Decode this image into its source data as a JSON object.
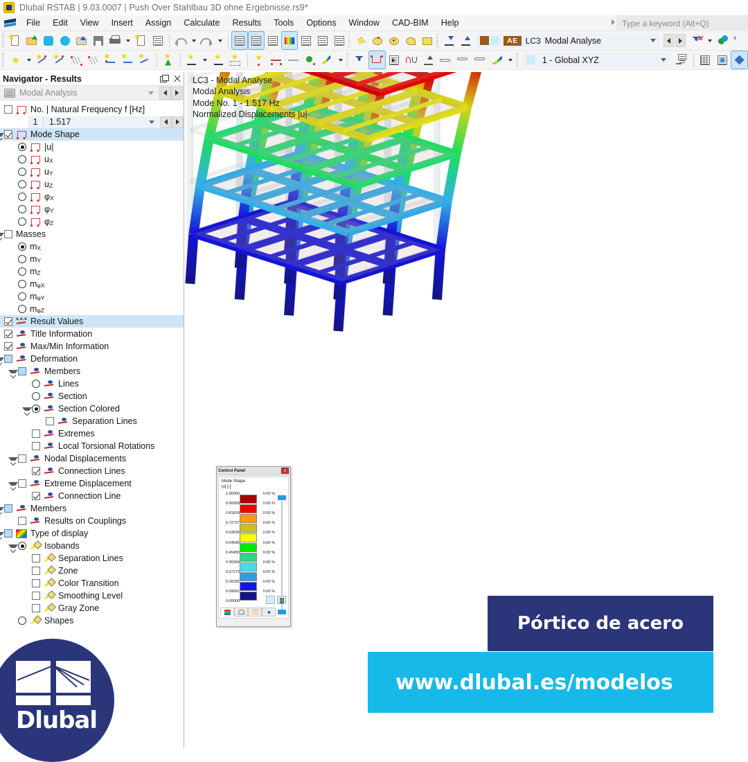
{
  "window": {
    "title": "Dlubal RSTAB | 9.03.0007 | Push Over Stahlbau 3D  ohne Ergebnisse.rs9*",
    "app_icon": "rstab-app-icon"
  },
  "menu": {
    "items": [
      "File",
      "Edit",
      "View",
      "Insert",
      "Assign",
      "Calculate",
      "Results",
      "Tools",
      "Options",
      "Window",
      "CAD-BIM",
      "Help"
    ],
    "search_placeholder": "Type a keyword (Alt+Q)"
  },
  "toolbar_top": {
    "buttons": [
      {
        "name": "new-model-icon",
        "kind": "page-star"
      },
      {
        "name": "open-folder-icon",
        "kind": "folder"
      },
      {
        "name": "rfem-link-icon",
        "kind": "blue-c"
      },
      {
        "name": "cloud-model-icon",
        "kind": "blue-globe"
      },
      {
        "name": "save-as-icon",
        "kind": "save-as"
      },
      {
        "name": "save-icon",
        "kind": "disk"
      },
      {
        "name": "print-icon",
        "kind": "printer"
      },
      {
        "name": "printout-report-icon",
        "kind": "page-star2"
      },
      {
        "name": "document-icon",
        "kind": "page"
      },
      {
        "name": "undo-icon",
        "kind": "undo"
      },
      {
        "name": "redo-icon",
        "kind": "redo"
      },
      {
        "name": "navigator-panel-icon",
        "kind": "panel"
      },
      {
        "name": "table-view-icon",
        "kind": "table"
      },
      {
        "name": "result-table-icon",
        "kind": "panel-color"
      },
      {
        "name": "console-icon",
        "kind": "console"
      },
      {
        "name": "script-icon",
        "kind": "script"
      },
      {
        "name": "info-panel-icon",
        "kind": "panel2"
      },
      {
        "name": "select-polygon-icon",
        "kind": "poly"
      },
      {
        "name": "select-special-icon",
        "kind": "lasso1"
      },
      {
        "name": "select-circle-icon",
        "kind": "lasso2"
      },
      {
        "name": "select-free-icon",
        "kind": "lasso3"
      },
      {
        "name": "select-box-icon",
        "kind": "boxplus"
      },
      {
        "name": "snap-top-icon",
        "kind": "snapt"
      },
      {
        "name": "snap-bottom-icon",
        "kind": "snapb"
      }
    ],
    "load_case": {
      "swatch_1": "#9c5a14",
      "swatch_2": "#c9f0f7",
      "badge": "AE",
      "id": "LC3",
      "description": "Modal Analyse"
    }
  },
  "toolbar_second": {
    "buttons": [
      {
        "name": "new-node-icon",
        "kind": "node"
      },
      {
        "name": "new-member-icon",
        "kind": "member1"
      },
      {
        "name": "new-member-2-icon",
        "kind": "member2"
      },
      {
        "name": "new-surface-icon",
        "kind": "surface1"
      },
      {
        "name": "new-surface-2-icon",
        "kind": "surface2"
      },
      {
        "name": "new-line-support-icon",
        "kind": "linesup"
      },
      {
        "name": "new-member-hinge-icon",
        "kind": "hinge"
      },
      {
        "name": "new-member-set-icon",
        "kind": "memberset"
      },
      {
        "name": "new-nodal-support-icon",
        "kind": "nodalsup"
      },
      {
        "name": "dimension-x-icon",
        "kind": "dimx"
      },
      {
        "name": "dimension-xx-icon",
        "kind": "dimxx"
      },
      {
        "name": "dimension-free-icon",
        "kind": "dimfree"
      },
      {
        "name": "new-load-icon",
        "kind": "loadstar"
      },
      {
        "name": "member-load-icon",
        "kind": "memberload"
      },
      {
        "name": "line-load-icon",
        "kind": "lineload"
      },
      {
        "name": "imperfection-icon",
        "kind": "imperf"
      },
      {
        "name": "load-wizard-icon",
        "kind": "wizard"
      },
      {
        "name": "render-filter-icon",
        "kind": "filter"
      },
      {
        "name": "deformation-view-icon",
        "kind": "defview"
      },
      {
        "name": "animation-icon",
        "kind": "anim"
      },
      {
        "name": "diagram-icon",
        "kind": "diagram"
      },
      {
        "name": "support-reaction-icon",
        "kind": "supreact"
      },
      {
        "name": "hinge-release-icon",
        "kind": "release1"
      },
      {
        "name": "hinge-release-2-icon",
        "kind": "release2"
      },
      {
        "name": "hinge-release-3-icon",
        "kind": "release3"
      },
      {
        "name": "color-scale-icon",
        "kind": "rainbow-pencil"
      },
      {
        "name": "coordinate-system-icon",
        "kind": "csys"
      },
      {
        "name": "grid-icon",
        "kind": "grid"
      },
      {
        "name": "snap-settings-icon",
        "kind": "snapset"
      },
      {
        "name": "ucs-icon",
        "kind": "ucs"
      }
    ],
    "coord_system": {
      "swatch": "#c9f0f7",
      "label": "1 - Global XYZ"
    }
  },
  "navigator": {
    "title": "Navigator - Results",
    "combo_label": "Modal Analysis",
    "tree": [
      {
        "id": "nat-freq",
        "indent": 1,
        "ctrl": "checkbox",
        "state": "off",
        "icon": "frame",
        "label": "No. | Natural Frequency f [Hz]",
        "expander": ""
      },
      {
        "id": "freq-combo",
        "indent": 2,
        "ctrl": "combo",
        "num": "1",
        "value": "1.517"
      },
      {
        "id": "mode-shape",
        "indent": 1,
        "ctrl": "checkbox",
        "state": "on",
        "icon": "frame",
        "label": "Mode Shape",
        "expander": "open",
        "selected": true
      },
      {
        "id": "u-abs",
        "indent": 2,
        "ctrl": "radio",
        "state": "on",
        "icon": "frame",
        "label": "|u|"
      },
      {
        "id": "ux",
        "indent": 2,
        "ctrl": "radio",
        "state": "off",
        "icon": "frame",
        "label": "u",
        "sub": "X"
      },
      {
        "id": "uy",
        "indent": 2,
        "ctrl": "radio",
        "state": "off",
        "icon": "frame",
        "label": "u",
        "sub": "Y"
      },
      {
        "id": "uz",
        "indent": 2,
        "ctrl": "radio",
        "state": "off",
        "icon": "frame",
        "label": "u",
        "sub": "Z"
      },
      {
        "id": "phix",
        "indent": 2,
        "ctrl": "radio",
        "state": "off",
        "icon": "frame",
        "label": "φ",
        "sub": "X"
      },
      {
        "id": "phiy",
        "indent": 2,
        "ctrl": "radio",
        "state": "off",
        "icon": "frame",
        "label": "φ",
        "sub": "Y"
      },
      {
        "id": "phiz",
        "indent": 2,
        "ctrl": "radio",
        "state": "off",
        "icon": "frame",
        "label": "φ",
        "sub": "Z"
      },
      {
        "id": "masses",
        "indent": 1,
        "ctrl": "checkbox",
        "state": "off",
        "icon": "none",
        "label": "Masses",
        "expander": "open"
      },
      {
        "id": "mx",
        "indent": 2,
        "ctrl": "radio",
        "state": "on",
        "icon": "none",
        "label": "m",
        "sub": "X"
      },
      {
        "id": "my",
        "indent": 2,
        "ctrl": "radio",
        "state": "off",
        "icon": "none",
        "label": "m",
        "sub": "Y"
      },
      {
        "id": "mz",
        "indent": 2,
        "ctrl": "radio",
        "state": "off",
        "icon": "none",
        "label": "m",
        "sub": "Z"
      },
      {
        "id": "mphix",
        "indent": 2,
        "ctrl": "radio",
        "state": "off",
        "icon": "none",
        "label": "m",
        "sub": "φX"
      },
      {
        "id": "mphiy",
        "indent": 2,
        "ctrl": "radio",
        "state": "off",
        "icon": "none",
        "label": "m",
        "sub": "φY"
      },
      {
        "id": "mphiz",
        "indent": 2,
        "ctrl": "radio",
        "state": "off",
        "icon": "none",
        "label": "m",
        "sub": "φZ"
      },
      {
        "id": "result-values",
        "indent": 1,
        "ctrl": "checkbox",
        "state": "on",
        "icon": "xxx",
        "label": "Result Values",
        "selected": true
      },
      {
        "id": "title-information",
        "indent": 1,
        "ctrl": "checkbox",
        "state": "on",
        "icon": "defo",
        "label": "Title Information"
      },
      {
        "id": "maxmin-information",
        "indent": 1,
        "ctrl": "checkbox",
        "state": "on",
        "icon": "defo",
        "label": "Max/Min Information"
      },
      {
        "id": "deformation",
        "indent": 1,
        "ctrl": "checkbox",
        "state": "part",
        "icon": "defo",
        "label": "Deformation",
        "expander": "open"
      },
      {
        "id": "def-members",
        "indent": 2,
        "ctrl": "checkbox",
        "state": "part",
        "icon": "defo",
        "label": "Members",
        "expander": "open"
      },
      {
        "id": "def-lines",
        "indent": 3,
        "ctrl": "radio",
        "state": "off",
        "icon": "defo",
        "label": "Lines"
      },
      {
        "id": "def-section",
        "indent": 3,
        "ctrl": "radio",
        "state": "off",
        "icon": "defo",
        "label": "Section"
      },
      {
        "id": "def-section-colored",
        "indent": 3,
        "ctrl": "radio",
        "state": "on",
        "icon": "defo",
        "label": "Section Colored",
        "expander": "open"
      },
      {
        "id": "def-separation-lines",
        "indent": 4,
        "ctrl": "checkbox",
        "state": "off",
        "icon": "defo",
        "label": "Separation Lines"
      },
      {
        "id": "def-extremes",
        "indent": 3,
        "ctrl": "checkbox",
        "state": "off",
        "icon": "defo",
        "label": "Extremes"
      },
      {
        "id": "def-local-torsional",
        "indent": 3,
        "ctrl": "checkbox",
        "state": "off",
        "icon": "defo",
        "label": "Local Torsional Rotations"
      },
      {
        "id": "nodal-displacements",
        "indent": 2,
        "ctrl": "checkbox",
        "state": "off",
        "icon": "defo",
        "label": "Nodal Displacements",
        "expander": "open"
      },
      {
        "id": "nd-connection-lines",
        "indent": 3,
        "ctrl": "checkbox",
        "state": "on",
        "icon": "defo",
        "label": "Connection Lines"
      },
      {
        "id": "extreme-displacement",
        "indent": 2,
        "ctrl": "checkbox",
        "state": "off",
        "icon": "defo",
        "label": "Extreme Displacement",
        "expander": "open"
      },
      {
        "id": "ed-connection-line",
        "indent": 3,
        "ctrl": "checkbox",
        "state": "on",
        "icon": "defo",
        "label": "Connection Line"
      },
      {
        "id": "members",
        "indent": 1,
        "ctrl": "checkbox",
        "state": "part",
        "icon": "defo",
        "label": "Members",
        "expander": "open"
      },
      {
        "id": "results-on-couplings",
        "indent": 2,
        "ctrl": "checkbox",
        "state": "off",
        "icon": "defo",
        "label": "Results on Couplings"
      },
      {
        "id": "type-of-display",
        "indent": 1,
        "ctrl": "checkbox",
        "state": "part",
        "icon": "rain",
        "label": "Type of display",
        "expander": "open"
      },
      {
        "id": "isobands",
        "indent": 2,
        "ctrl": "radio",
        "state": "on",
        "icon": "pencil",
        "label": "Isobands",
        "expander": "open"
      },
      {
        "id": "iso-separation-lines",
        "indent": 3,
        "ctrl": "checkbox",
        "state": "off",
        "icon": "pencil",
        "label": "Separation Lines"
      },
      {
        "id": "iso-zone",
        "indent": 3,
        "ctrl": "checkbox",
        "state": "off",
        "icon": "pencil",
        "label": "Zone"
      },
      {
        "id": "iso-color-transition",
        "indent": 3,
        "ctrl": "checkbox",
        "state": "off",
        "icon": "pencil",
        "label": "Color Transition"
      },
      {
        "id": "iso-smoothing-level",
        "indent": 3,
        "ctrl": "checkbox",
        "state": "off",
        "icon": "pencil",
        "label": "Smoothing Level"
      },
      {
        "id": "iso-gray-zone",
        "indent": 3,
        "ctrl": "checkbox",
        "state": "off",
        "icon": "pencil",
        "label": "Gray Zone"
      },
      {
        "id": "shapes",
        "indent": 2,
        "ctrl": "radio",
        "state": "off",
        "icon": "pencil",
        "label": "Shapes"
      }
    ]
  },
  "viewport": {
    "title_lines": [
      "LC3 - Modal Analyse",
      "Modal Analysis",
      "Mode No. 1 - 1.517 Hz",
      "Normalized Displacements |u|"
    ]
  },
  "control_panel": {
    "title": "Control Panel",
    "close_label": "x",
    "subtitle_line1": "Mode Shape",
    "subtitle_line2": "|u| [-]",
    "legend": [
      {
        "value": "1.00000",
        "color": "#a80000",
        "pct": "0.00 %"
      },
      {
        "value": "0.90909",
        "color": "#f50000",
        "pct": "0.00 %"
      },
      {
        "value": "0.81818",
        "color": "#ff9a00",
        "pct": "0.00 %"
      },
      {
        "value": "0.72727",
        "color": "#c8c221",
        "pct": "0.00 %"
      },
      {
        "value": "0.63636",
        "color": "#fdfd00",
        "pct": "0.00 %"
      },
      {
        "value": "0.54545",
        "color": "#00e800",
        "pct": "0.00 %"
      },
      {
        "value": "0.45455",
        "color": "#2ad888",
        "pct": "0.00 %"
      },
      {
        "value": "0.36364",
        "color": "#40e0e8",
        "pct": "0.00 %"
      },
      {
        "value": "0.27273",
        "color": "#2c9ce8",
        "pct": "0.00 %"
      },
      {
        "value": "0.18182",
        "color": "#1414ee",
        "pct": "0.00 %"
      },
      {
        "value": "0.09091",
        "color": "#141487",
        "pct": "0.00 %"
      },
      {
        "value": "0.00000",
        "color": "",
        "pct": ""
      }
    ],
    "tabs": [
      "color-scale-tab",
      "factors-tab",
      "filter-tab",
      "display-tab"
    ],
    "tools": [
      "edit-scale-icon",
      "color-spectrum-icon"
    ]
  },
  "branding": {
    "logo_text": "Dlubal",
    "banner_model": "Pórtico de acero",
    "banner_url": "www.dlubal.es/modelos",
    "dark_color": "#2b3579",
    "cyan_color": "#16b9e8"
  },
  "chart_data": {
    "type": "heatmap",
    "title": "Mode Shape |u| [-]",
    "legend_values": [
      1.0,
      0.90909,
      0.81818,
      0.72727,
      0.63636,
      0.54545,
      0.45455,
      0.36364,
      0.27273,
      0.18182,
      0.09091,
      0.0
    ],
    "legend_colors": [
      "#a80000",
      "#f50000",
      "#ff9a00",
      "#c8c221",
      "#fdfd00",
      "#00e800",
      "#2ad888",
      "#40e0e8",
      "#2c9ce8",
      "#1414ee",
      "#141487"
    ],
    "legend_percentages": [
      "0.00 %",
      "0.00 %",
      "0.00 %",
      "0.00 %",
      "0.00 %",
      "0.00 %",
      "0.00 %",
      "0.00 %",
      "0.00 %",
      "0.00 %",
      "0.00 %"
    ],
    "frequency_hz": 1.517,
    "mode_number": 1,
    "ylabel": "|u| [-]"
  }
}
